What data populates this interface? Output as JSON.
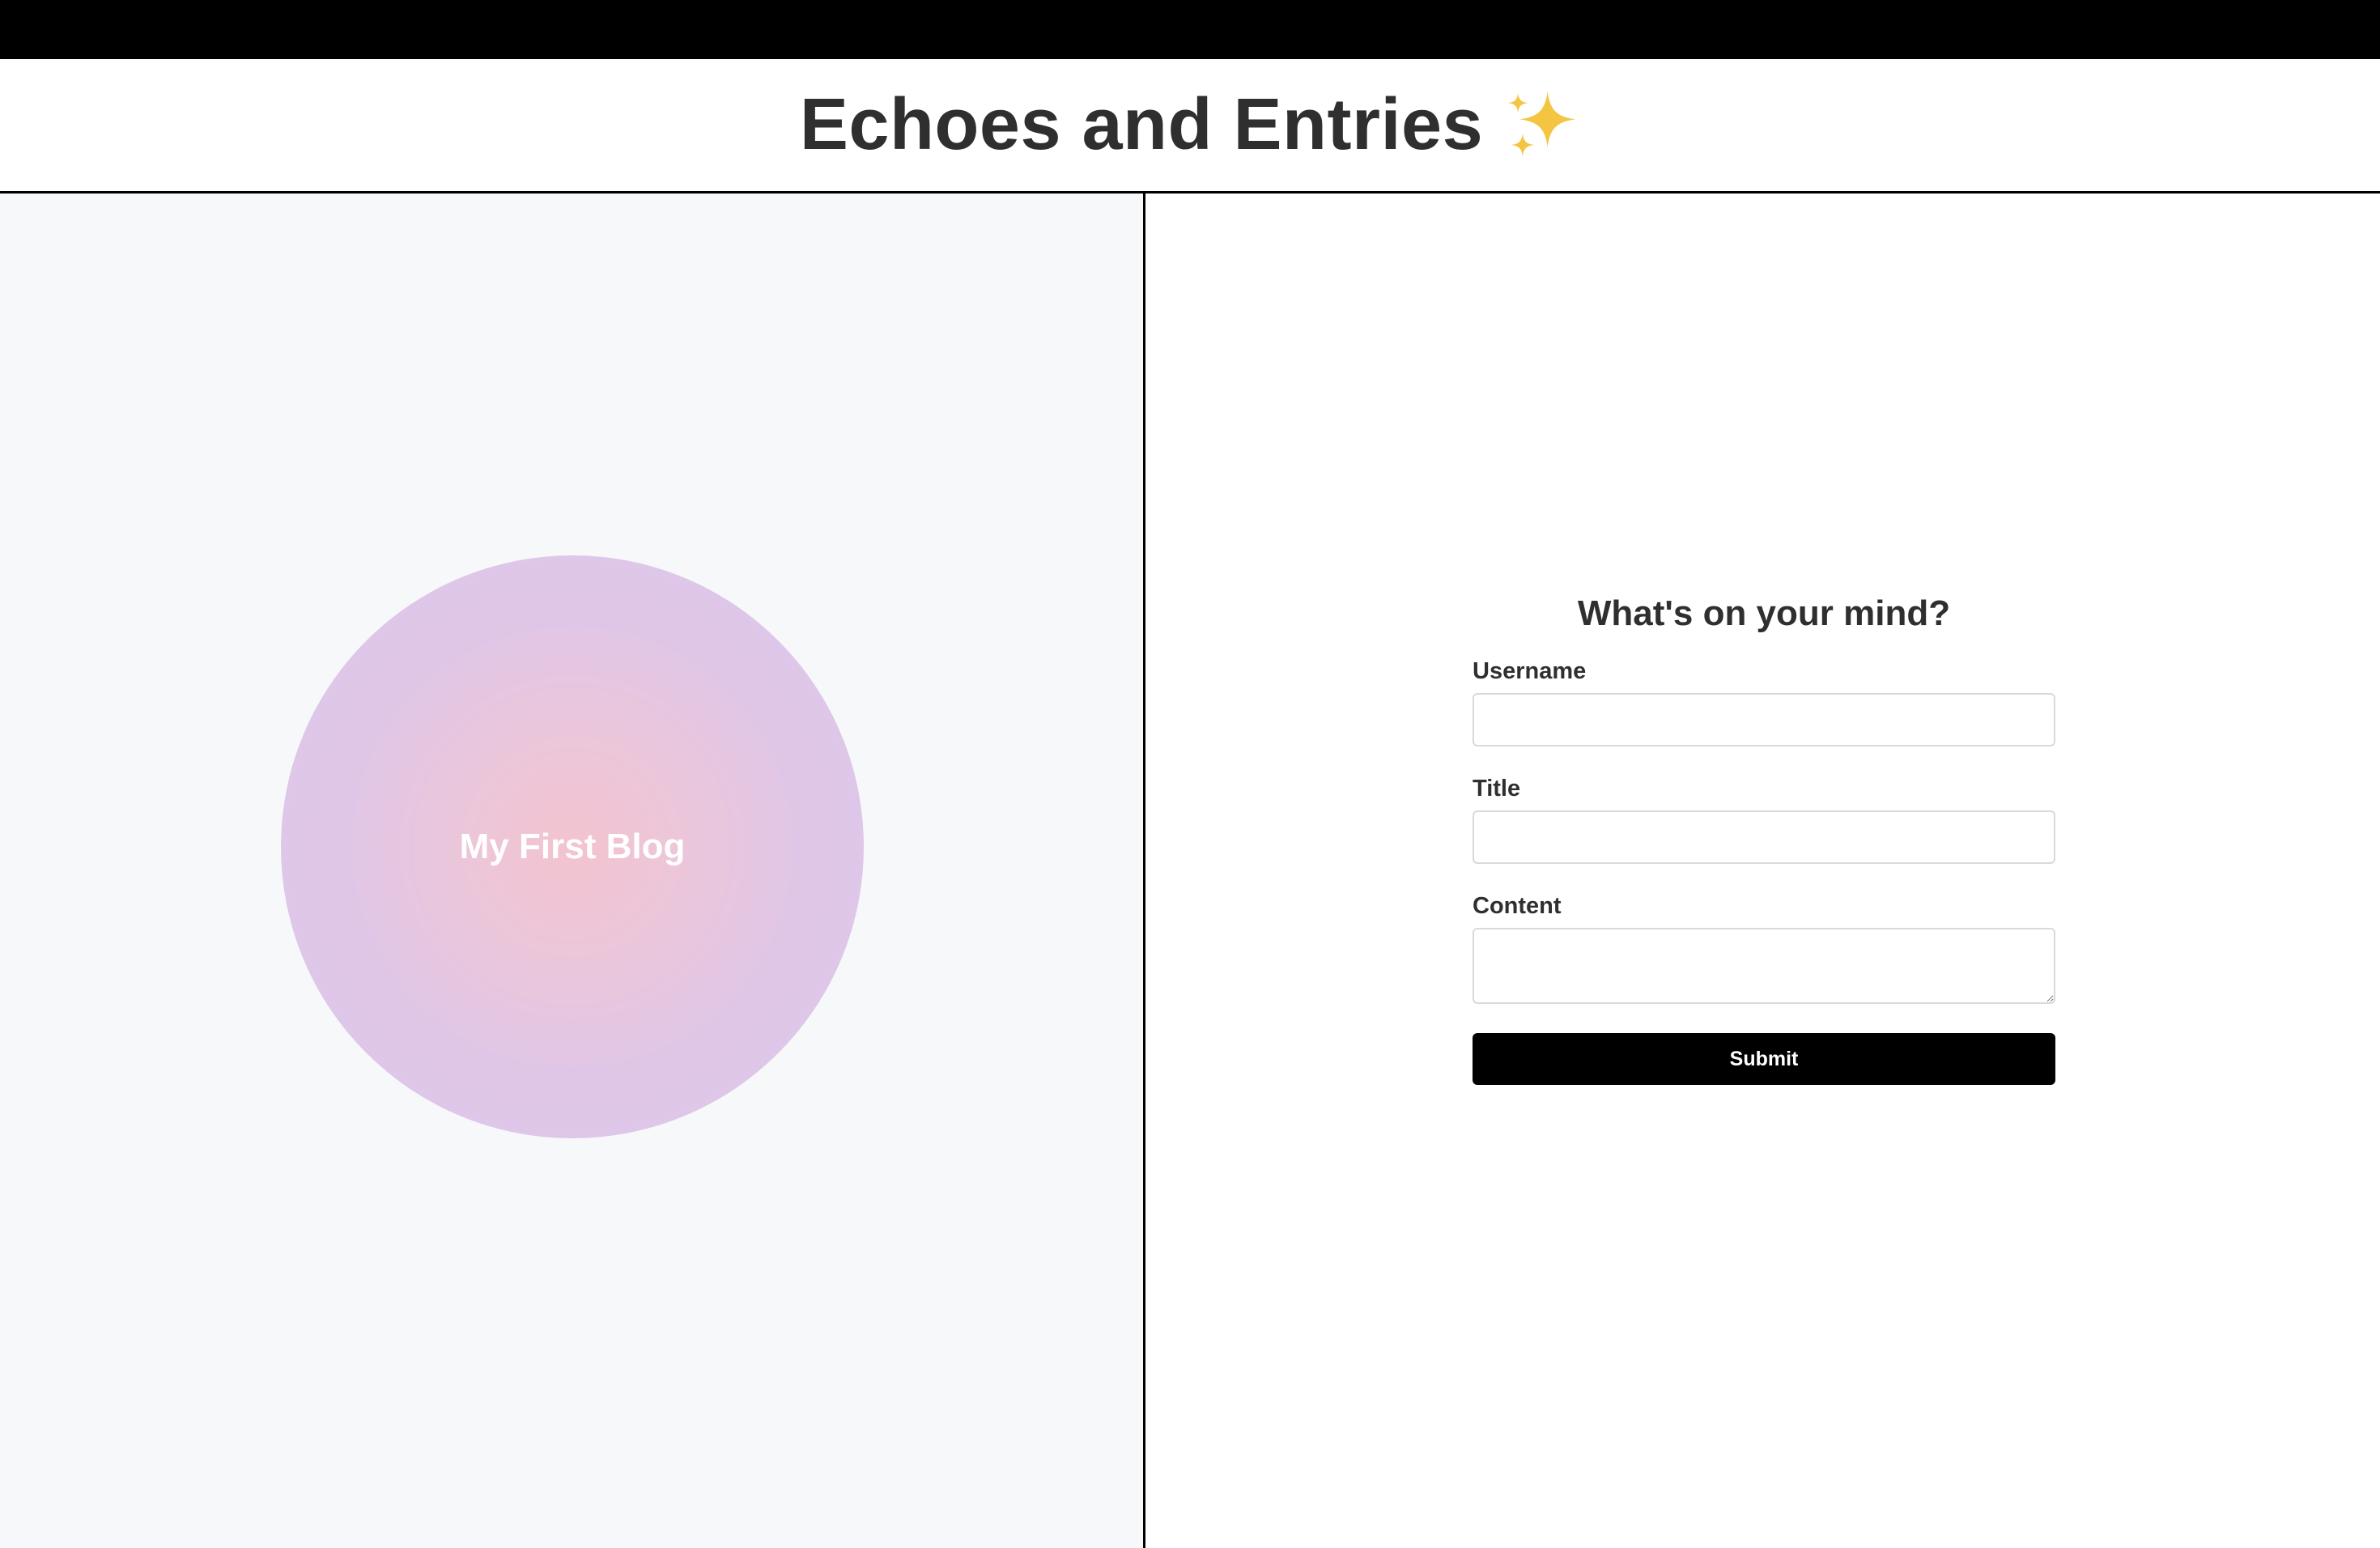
{
  "header": {
    "title": "Echoes and Entries",
    "title_icon": "sparkles-icon"
  },
  "blog_list": {
    "items": [
      {
        "title": "My First Blog"
      }
    ]
  },
  "form": {
    "heading": "What's on your mind?",
    "username_label": "Username",
    "username_value": "",
    "title_label": "Title",
    "title_value": "",
    "content_label": "Content",
    "content_value": "",
    "submit_label": "Submit"
  },
  "colors": {
    "top_bar": "#000000",
    "left_pane_bg": "#f7f8fa",
    "circle_center": "#f3c3cf",
    "circle_edge": "#d9c8eb",
    "button_bg": "#000000",
    "text": "#2f2f2f"
  }
}
